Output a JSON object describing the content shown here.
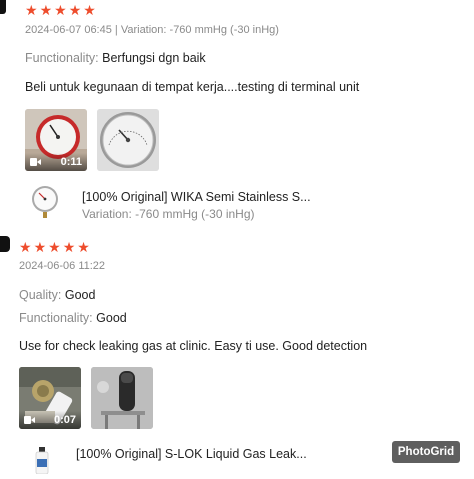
{
  "review1": {
    "stars": [
      "★",
      "★",
      "★",
      "★",
      "★"
    ],
    "meta": "2024-06-07 06:45 | Variation: -760 mmHg (-30 inHg)",
    "functionality_label": "Functionality:",
    "functionality_value": "Berfungsi dgn baik",
    "text": "Beli untuk kegunaan di tempat kerja....testing di terminal unit",
    "media": [
      {
        "type": "video",
        "duration": "0:11"
      },
      {
        "type": "image"
      }
    ],
    "product": {
      "name": "[100% Original] WIKA Semi Stainless S...",
      "variation": "Variation: -760 mmHg (-30 inHg)"
    }
  },
  "review2": {
    "stars": [
      "★",
      "★",
      "★",
      "★",
      "★"
    ],
    "meta": "2024-06-06 11:22",
    "quality_label": "Quality:",
    "quality_value": "Good",
    "functionality_label": "Functionality:",
    "functionality_value": "Good",
    "text": "Use for check leaking gas at clinic. Easy ti use. Good detection",
    "media": [
      {
        "type": "video",
        "duration": "0:07"
      },
      {
        "type": "image"
      }
    ],
    "product": {
      "name": "[100% Original] S-LOK Liquid Gas Leak..."
    }
  },
  "watermark": "PhotoGrid",
  "colors": {
    "star": "#ee4d2d",
    "muted": "#8a8a8a",
    "text": "#222222"
  }
}
